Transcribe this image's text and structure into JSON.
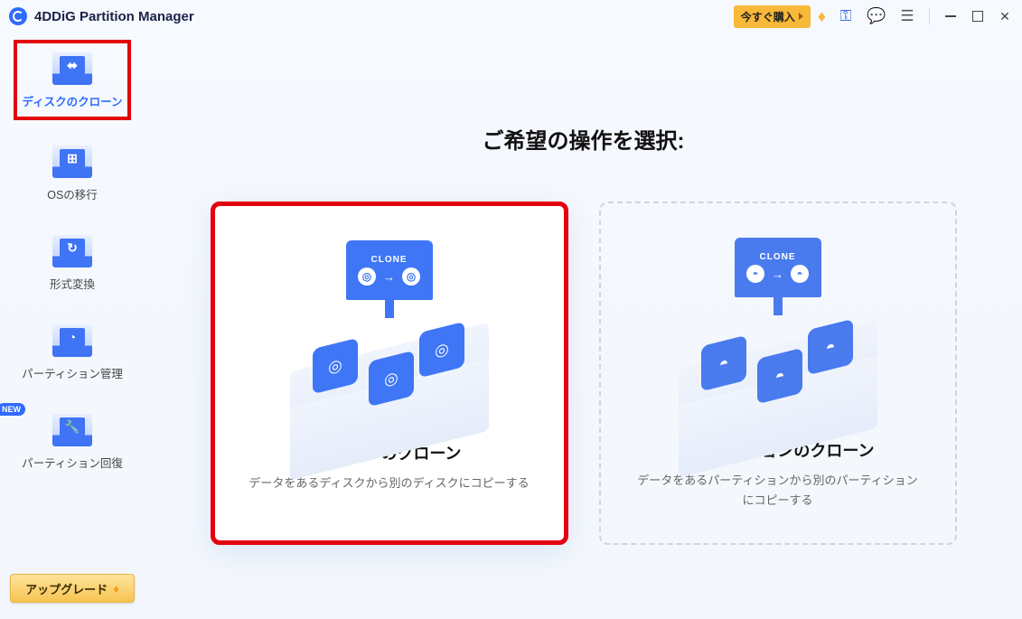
{
  "titlebar": {
    "app_title": "4DDiG Partition Manager",
    "buy_label": "今すぐ購入"
  },
  "sidebar": {
    "items": [
      {
        "label": "ディスクのクローン",
        "glyph": "⬌"
      },
      {
        "label": "OSの移行",
        "glyph": "⊞"
      },
      {
        "label": "形式変換",
        "glyph": "↻"
      },
      {
        "label": "パーティション管理",
        "glyph": "◔"
      },
      {
        "label": "パーティション回復",
        "glyph": "🔧",
        "new_badge": "NEW"
      }
    ],
    "upgrade_label": "アップグレード"
  },
  "main": {
    "heading": "ご希望の操作を選択:",
    "cards": [
      {
        "clone_label": "CLONE",
        "title": "ディスクのクローン",
        "subtitle": "データをあるディスクから別のディスクにコピーする",
        "disk_glyph": "◎"
      },
      {
        "clone_label": "CLONE",
        "title": "パーティションのクローン",
        "subtitle": "データをあるパーティションから別のパーティションにコピーする",
        "disk_glyph": "◓"
      }
    ]
  }
}
